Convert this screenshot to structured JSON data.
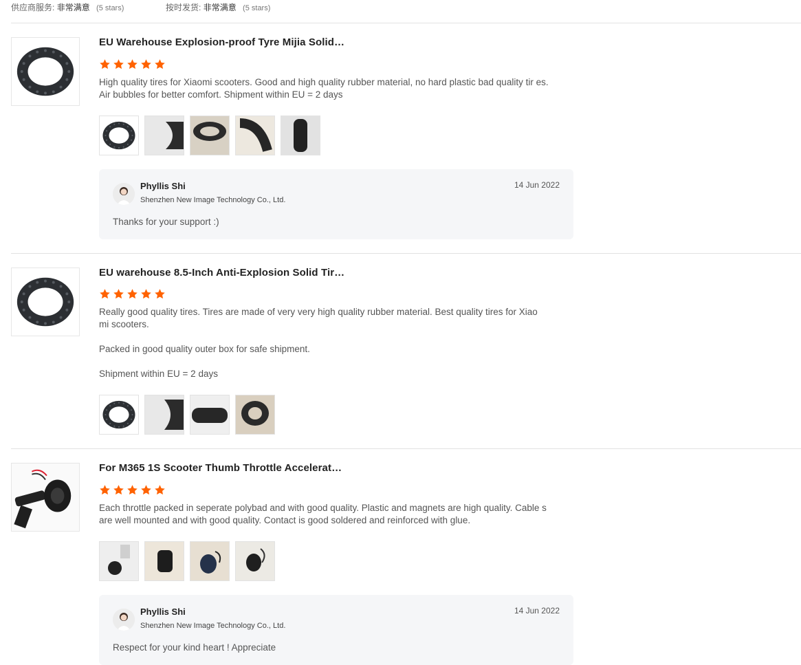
{
  "topbar": {
    "service_label": "供应商服务:",
    "service_value": "非常满意",
    "service_stars": "(5 stars)",
    "shipping_label": "按时发货:",
    "shipping_value": "非常满意",
    "shipping_stars": "(5 stars)"
  },
  "colors": {
    "star": "#ff6200",
    "reply_bg": "#f5f6f8",
    "divider": "#e2e2e2"
  },
  "reviews": [
    {
      "title": "EU Warehouse Explosion-proof Tyre Mijia Solid…",
      "rating": 5,
      "paragraphs": [
        "High quality tires for Xiaomi scooters. Good and high quality rubber material, no hard plastic bad quality tir es. Air bubbles for better comfort. Shipment within EU = 2 days"
      ],
      "photo_count": 5,
      "reply": {
        "name": "Phyllis Shi",
        "company": "Shenzhen New Image Technology Co., Ltd.",
        "date": "14 Jun 2022",
        "text": "Thanks for your support :)"
      }
    },
    {
      "title": "EU warehouse 8.5-Inch Anti-Explosion Solid Tir…",
      "rating": 5,
      "paragraphs": [
        "Really good quality tires. Tires are made of very very high quality rubber material. Best quality tires for Xiao mi scooters.",
        "Packed in good quality outer box for safe shipment.",
        "Shipment within EU = 2 days"
      ],
      "photo_count": 4
    },
    {
      "title": "For M365 1S Scooter Thumb Throttle Accelerat…",
      "rating": 5,
      "paragraphs": [
        "Each throttle packed in seperate polybad and with good quality. Plastic and magnets are high quality. Cable s are well mounted and with good quality. Contact is good soldered and reinforced with glue."
      ],
      "photo_count": 4,
      "reply": {
        "name": "Phyllis Shi",
        "company": "Shenzhen New Image Technology Co., Ltd.",
        "date": "14 Jun 2022",
        "text": "Respect for your kind heart !  Appreciate"
      }
    }
  ]
}
